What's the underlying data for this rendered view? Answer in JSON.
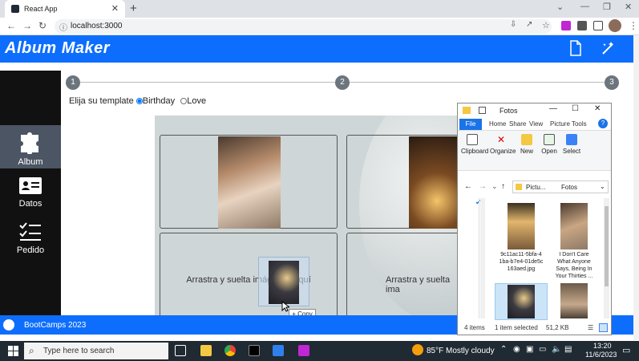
{
  "browser": {
    "tab_title": "React App",
    "url": "localhost:3000"
  },
  "app": {
    "brand": "Album Maker",
    "sidebar": [
      {
        "label": "Album",
        "icon": "puzzle-icon",
        "active": true
      },
      {
        "label": "Datos",
        "icon": "id-card-icon",
        "active": false
      },
      {
        "label": "Pedido",
        "icon": "checklist-icon",
        "active": false
      }
    ],
    "steps": [
      "1",
      "2",
      "3"
    ],
    "template_prompt": "Elija su template",
    "template_options": [
      {
        "label": "Birthday",
        "checked": true
      },
      {
        "label": "Love",
        "checked": false
      }
    ],
    "slot_hint": "Arrastra y suelta imágenes aquí",
    "slot_hint_2": "Arrastra y suelta ima",
    "footer": "BootCamps 2023",
    "drag_copy_label": "+ Copy"
  },
  "explorer": {
    "title": "Fotos",
    "tabs": [
      "File",
      "Home",
      "Share",
      "View",
      "Picture Tools"
    ],
    "ribbon": [
      "Clipboard",
      "Organize",
      "New",
      "Open",
      "Select"
    ],
    "breadcrumb_root": "Pictu...",
    "breadcrumb_current": "Fotos",
    "files": [
      {
        "name": "9c11ac11-5bfa-4 1ba-b7e4-01de5c 163aed.jpg"
      },
      {
        "name": "I Don't Care What Anyone Says, Being In Your Thirties ..."
      }
    ],
    "status_items": "4 items",
    "status_selected": "1 item selected",
    "status_size": "51,2 KB"
  },
  "taskbar": {
    "search_placeholder": "Type here to search",
    "weather": "85°F  Mostly cloudy",
    "time": "13:20",
    "date": "11/6/2023"
  }
}
